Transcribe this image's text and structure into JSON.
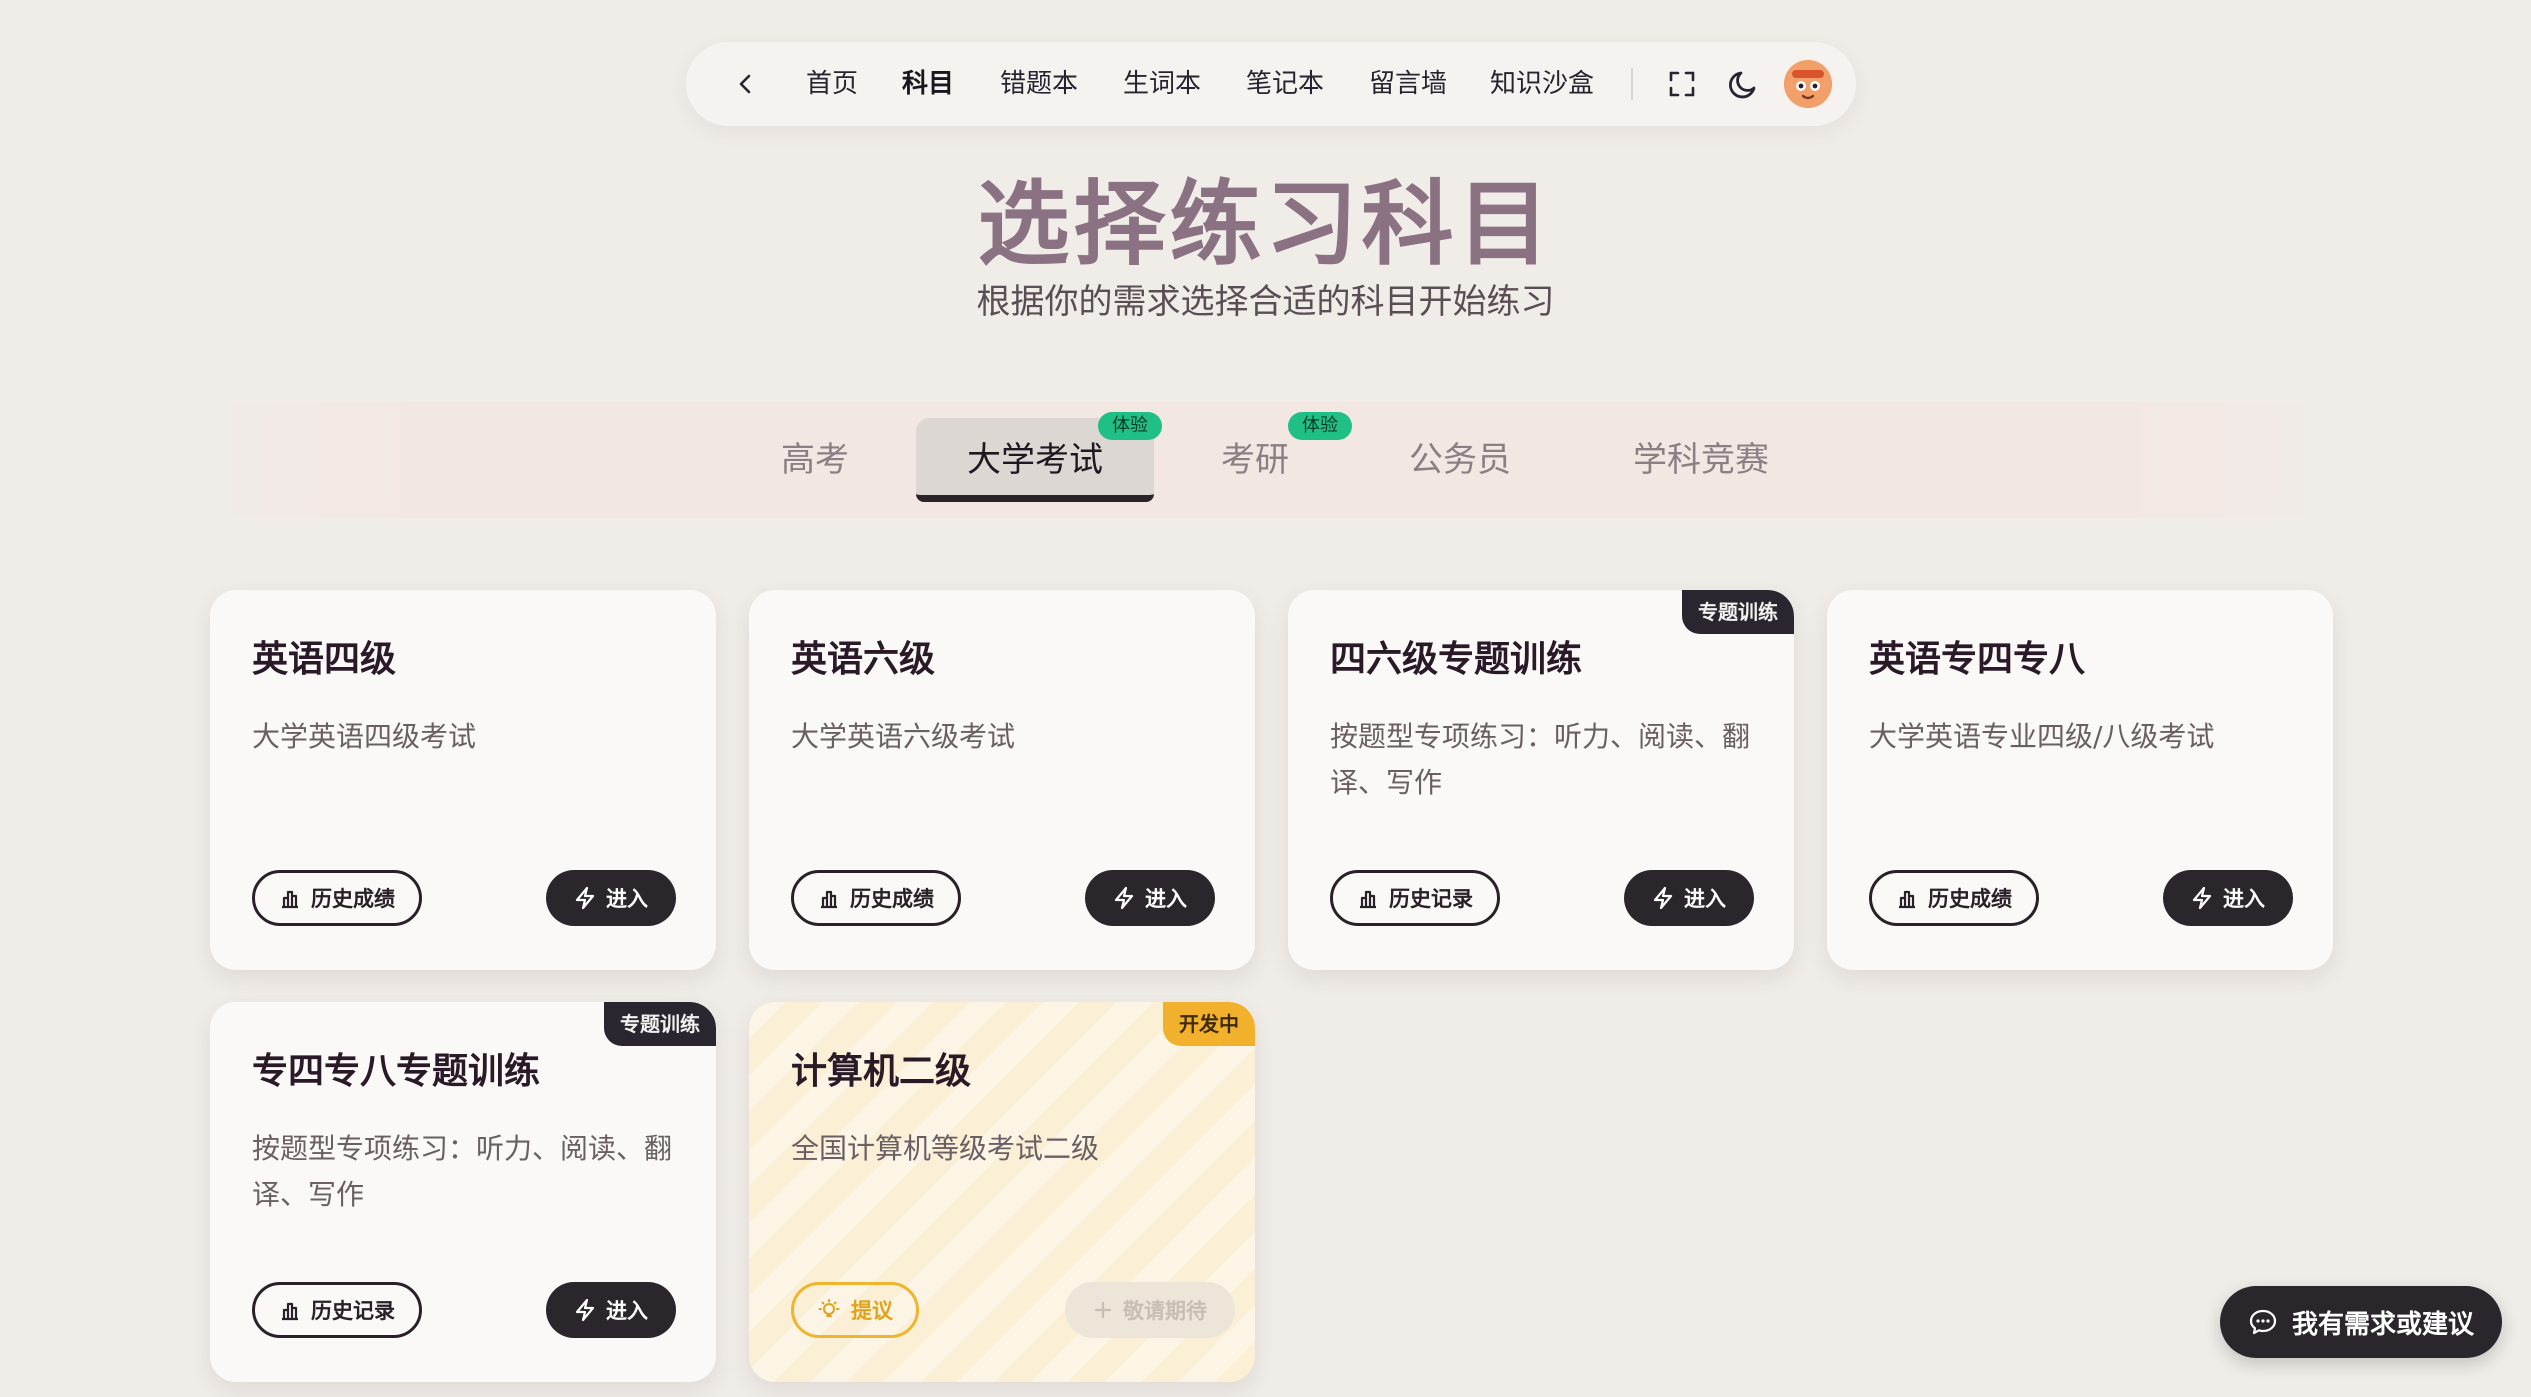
{
  "nav": {
    "items": [
      "首页",
      "科目",
      "错题本",
      "生词本",
      "笔记本",
      "留言墙",
      "知识沙盒"
    ],
    "active_index": 1
  },
  "page": {
    "title": "选择练习科目",
    "subtitle": "根据你的需求选择合适的科目开始练习"
  },
  "tabs": {
    "items": [
      {
        "label": "高考",
        "badge": ""
      },
      {
        "label": "大学考试",
        "badge": "体验"
      },
      {
        "label": "考研",
        "badge": "体验"
      },
      {
        "label": "公务员",
        "badge": ""
      },
      {
        "label": "学科竞赛",
        "badge": ""
      }
    ],
    "active_index": 1
  },
  "cards": [
    {
      "title": "英语四级",
      "desc": "大学英语四级考试",
      "tag": "",
      "history_label": "历史成绩",
      "enter_label": "进入"
    },
    {
      "title": "英语六级",
      "desc": "大学英语六级考试",
      "tag": "",
      "history_label": "历史成绩",
      "enter_label": "进入"
    },
    {
      "title": "四六级专题训练",
      "desc": "按题型专项练习：听力、阅读、翻译、写作",
      "tag": "专题训练",
      "history_label": "历史记录",
      "enter_label": "进入"
    },
    {
      "title": "英语专四专八",
      "desc": "大学英语专业四级/八级考试",
      "tag": "",
      "history_label": "历史成绩",
      "enter_label": "进入"
    },
    {
      "title": "专四专八专题训练",
      "desc": "按题型专项练习：听力、阅读、翻译、写作",
      "tag": "专题训练",
      "history_label": "历史记录",
      "enter_label": "进入"
    },
    {
      "title": "计算机二级",
      "desc": "全国计算机等级考试二级",
      "tag": "开发中",
      "history_label": "提议",
      "enter_label": "敬请期待"
    }
  ],
  "feedback": {
    "label": "我有需求或建议"
  },
  "colors": {
    "background": "#f0ece8",
    "title": "#8a7282",
    "badge_green": "#1fbf86",
    "dev_yellow": "#f2b12c",
    "dark": "#2a262b"
  },
  "icons": {
    "back": "chevron-left-icon",
    "fullscreen": "fullscreen-icon",
    "theme": "moon-icon",
    "history": "bar-chart-icon",
    "enter": "lightning-icon",
    "suggest": "lightbulb-icon",
    "coming_soon": "plus-icon",
    "feedback": "chat-bubble-icon"
  }
}
